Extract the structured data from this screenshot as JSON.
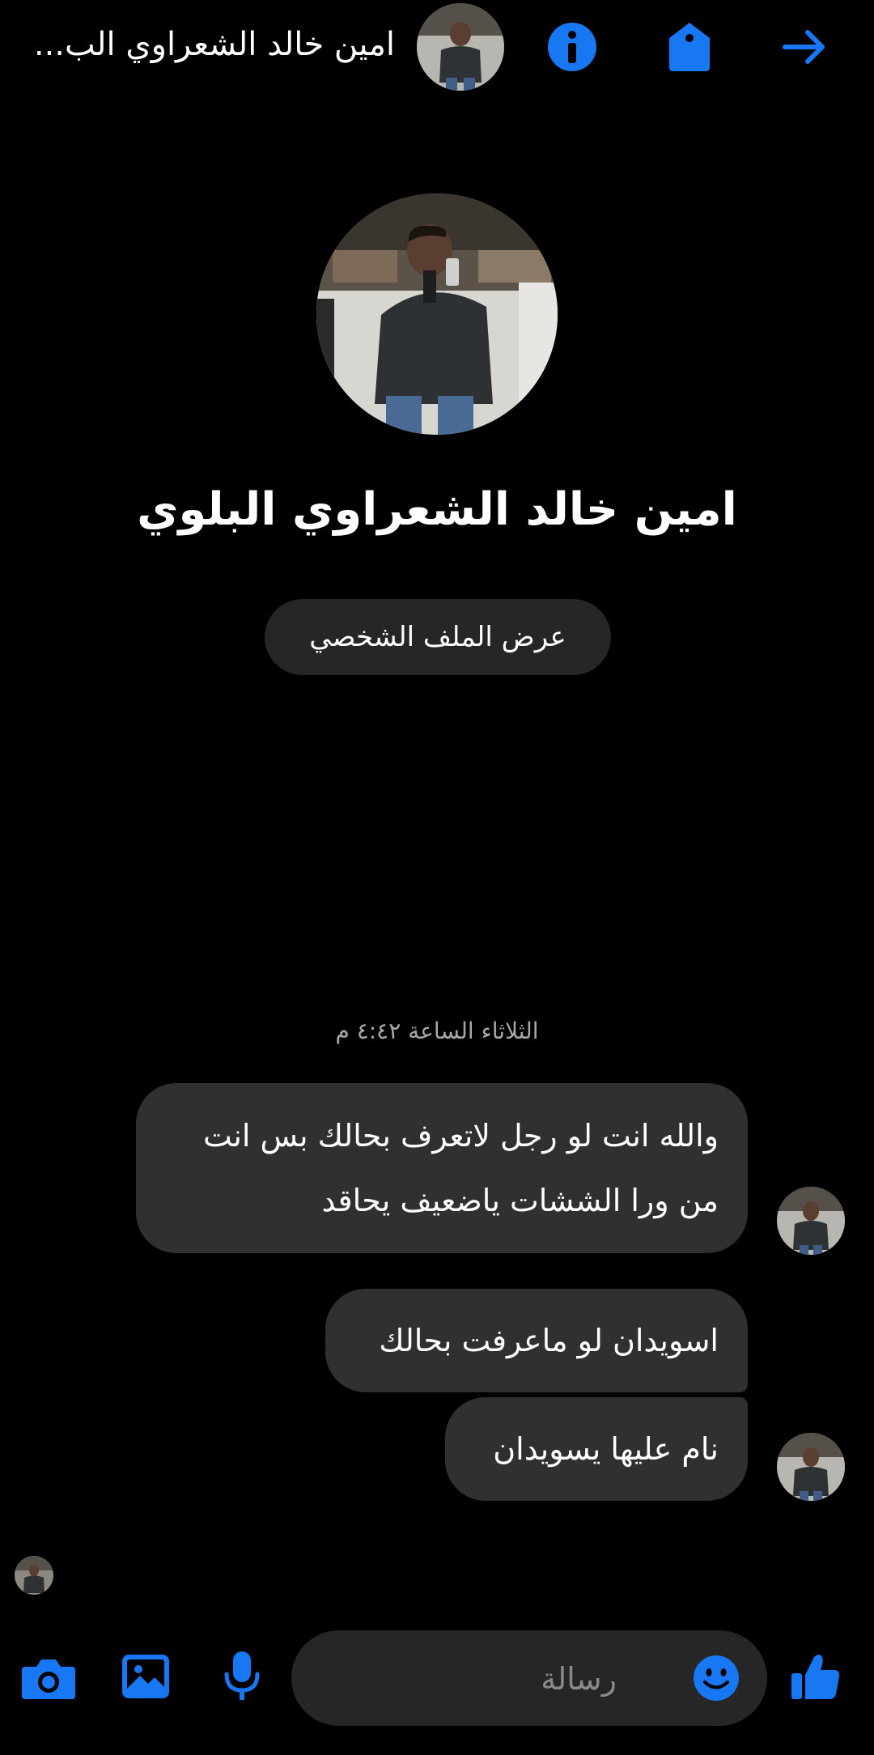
{
  "header": {
    "title": "امين خالد الشعراوي الب...",
    "icons": [
      "back-arrow-icon",
      "tag-icon",
      "info-icon"
    ]
  },
  "profile": {
    "name": "امين خالد الشعراوي البلوي",
    "view_profile_label": "عرض الملف الشخصي"
  },
  "conversation": {
    "timestamp": "الثلاثاء الساعة ٤:٤٢ م",
    "messages": [
      {
        "lines": [
          "والله انت لو رجل لاتعرف بحالك بس انت",
          "من ورا الششات ياضعيف يحاقد"
        ]
      },
      {
        "lines": [
          "اسويدان لو ماعرفت بحالك"
        ]
      },
      {
        "lines": [
          "نام عليها يسويدان"
        ]
      }
    ]
  },
  "composer": {
    "placeholder": "رسالة",
    "icons": [
      "camera-icon",
      "gallery-icon",
      "microphone-icon",
      "emoji-icon",
      "like-icon"
    ]
  },
  "colors": {
    "accent": "#1877F2",
    "background": "#000000",
    "bubble": "#303030",
    "pill": "#262626"
  }
}
